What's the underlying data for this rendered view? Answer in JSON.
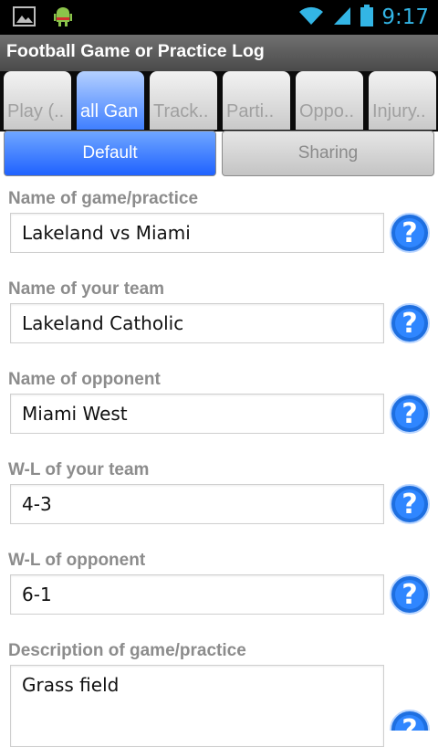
{
  "status_bar": {
    "time": "9:17",
    "icons": [
      "image-icon",
      "android-icon",
      "wifi-icon",
      "signal-icon",
      "battery-icon"
    ]
  },
  "app": {
    "title": "Football Game or Practice Log"
  },
  "tabs": [
    {
      "label": "Play (..",
      "active": false
    },
    {
      "label": "all Gan",
      "active": true
    },
    {
      "label": "Track..",
      "active": false
    },
    {
      "label": "Parti..",
      "active": false
    },
    {
      "label": "Oppo..",
      "active": false
    },
    {
      "label": "Injury..",
      "active": false
    }
  ],
  "segments": {
    "default_label": "Default",
    "sharing_label": "Sharing"
  },
  "form": {
    "fields": [
      {
        "label": "Name of game/practice",
        "value": "Lakeland vs Miami"
      },
      {
        "label": "Name of your team",
        "value": "Lakeland Catholic"
      },
      {
        "label": "Name of opponent",
        "value": "Miami West"
      },
      {
        "label": "W-L of your team",
        "value": "4-3"
      },
      {
        "label": "W-L of opponent",
        "value": "6-1"
      },
      {
        "label": "Description of game/practice",
        "value": "Grass field"
      }
    ]
  },
  "colors": {
    "accent_blue": "#2f6fff",
    "status_time": "#33b5e5",
    "label_gray": "#8c8c8c"
  }
}
